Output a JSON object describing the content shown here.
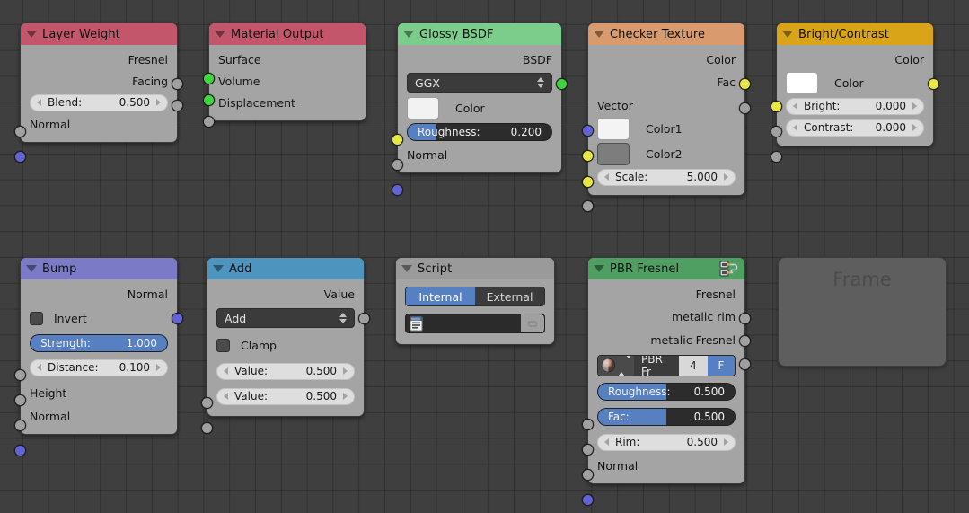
{
  "editor": {
    "name": "blender-node-editor",
    "background": "#3f3f3f"
  },
  "nodes": [
    {
      "id": "layer-weight",
      "title": "Layer Weight",
      "header_color": "#c4566b",
      "outputs": [
        {
          "label": "Fresnel",
          "socket": "gray"
        },
        {
          "label": "Facing",
          "socket": "gray"
        }
      ],
      "fields": [
        {
          "type": "number",
          "name": "Blend:",
          "value": "0.500",
          "socket": "gray"
        }
      ],
      "inputs": [
        {
          "label": "Normal",
          "socket": "blue"
        }
      ]
    },
    {
      "id": "material-output",
      "title": "Material Output",
      "header_color": "#c4566b",
      "inputs": [
        {
          "label": "Surface",
          "socket": "green"
        },
        {
          "label": "Volume",
          "socket": "green"
        },
        {
          "label": "Displacement",
          "socket": "gray"
        }
      ]
    },
    {
      "id": "glossy-bsdf",
      "title": "Glossy BSDF",
      "header_color": "#7ccd8b",
      "outputs": [
        {
          "label": "BSDF",
          "socket": "green"
        }
      ],
      "dropdown": {
        "value": "GGX"
      },
      "swatch": {
        "label": "Color",
        "color": "#f2f2f2",
        "socket": "yellow"
      },
      "slider": {
        "name": "Roughness:",
        "value": "0.200",
        "fill_pct": 20,
        "socket": "gray"
      },
      "inputs": [
        {
          "label": "Normal",
          "socket": "blue"
        }
      ]
    },
    {
      "id": "checker-texture",
      "title": "Checker Texture",
      "header_color": "#d99b6e",
      "outputs": [
        {
          "label": "Color",
          "socket": "yellow"
        },
        {
          "label": "Fac",
          "socket": "gray"
        }
      ],
      "inputs": [
        {
          "label": "Vector",
          "socket": "blue"
        }
      ],
      "swatches": [
        {
          "label": "Color1",
          "color": "#f4f4f4",
          "socket": "yellow"
        },
        {
          "label": "Color2",
          "color": "#7d7d7d",
          "socket": "yellow"
        }
      ],
      "fields": [
        {
          "type": "number",
          "name": "Scale:",
          "value": "5.000",
          "socket": "gray"
        }
      ]
    },
    {
      "id": "bright-contrast",
      "title": "Bright/Contrast",
      "header_color": "#d9a418",
      "outputs": [
        {
          "label": "Color",
          "socket": "yellow"
        }
      ],
      "swatch": {
        "label": "Color",
        "color": "#ffffff",
        "socket": "yellow"
      },
      "fields": [
        {
          "type": "number",
          "name": "Bright:",
          "value": "0.000",
          "socket": "gray"
        },
        {
          "type": "number",
          "name": "Contrast:",
          "value": "0.000",
          "socket": "gray"
        }
      ]
    },
    {
      "id": "bump",
      "title": "Bump",
      "header_color": "#7a7ac7",
      "outputs": [
        {
          "label": "Normal",
          "socket": "blue"
        }
      ],
      "checkbox": {
        "label": "Invert",
        "checked": false
      },
      "slider": {
        "name": "Strength:",
        "value": "1.000",
        "fill_pct": 100,
        "socket": "gray"
      },
      "fields": [
        {
          "type": "number",
          "name": "Distance:",
          "value": "0.100",
          "socket": "gray"
        }
      ],
      "inputs": [
        {
          "label": "Height",
          "socket": "gray"
        },
        {
          "label": "Normal",
          "socket": "blue"
        }
      ]
    },
    {
      "id": "add-math",
      "title": "Add",
      "header_color": "#4d94bf",
      "outputs": [
        {
          "label": "Value",
          "socket": "gray"
        }
      ],
      "dropdown": {
        "value": "Add"
      },
      "checkbox": {
        "label": "Clamp",
        "checked": false
      },
      "fields": [
        {
          "type": "number",
          "name": "Value:",
          "value": "0.500",
          "socket": "gray"
        },
        {
          "type": "number",
          "name": "Value:",
          "value": "0.500",
          "socket": "gray"
        }
      ]
    },
    {
      "id": "script",
      "title": "Script",
      "header_color": "#9a9a9a",
      "toggle": {
        "options": [
          "Internal",
          "External"
        ],
        "selected": "Internal"
      },
      "text_field": {
        "value": "",
        "icon": "text-datablock-icon",
        "action_icon": "refresh-icon"
      }
    },
    {
      "id": "pbr-fresnel",
      "title": "PBR Fresnel",
      "header_color": "#4f9f63",
      "header_icon": "node-group-icon",
      "outputs": [
        {
          "label": "Fresnel",
          "socket": "gray"
        },
        {
          "label": "metalic rim",
          "socket": "gray"
        },
        {
          "label": "metalic Fresnel",
          "socket": "gray"
        }
      ],
      "datablock": {
        "name": "PBR Fr",
        "count": "4",
        "fake_user": "F",
        "icon": "material-preview-icon"
      },
      "sliders": [
        {
          "name": "Roughness:",
          "value": "0.500",
          "fill_pct": 50,
          "socket": "gray"
        },
        {
          "name": "Fac:",
          "value": "0.500",
          "fill_pct": 50,
          "socket": "gray"
        }
      ],
      "fields": [
        {
          "type": "number",
          "name": "Rim:",
          "value": "0.500",
          "socket": "gray"
        }
      ],
      "inputs": [
        {
          "label": "Normal",
          "socket": "blue"
        }
      ]
    },
    {
      "id": "frame",
      "title": "Frame",
      "header_color": "#5e5e5e"
    }
  ]
}
